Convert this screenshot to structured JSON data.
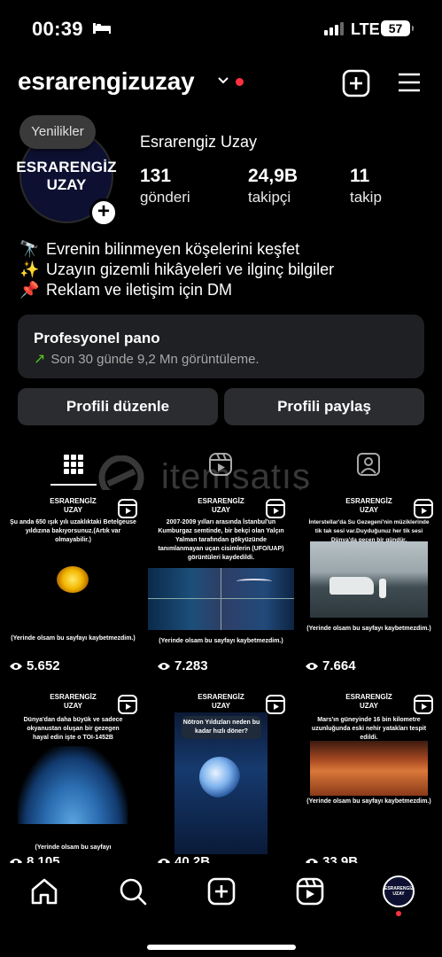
{
  "status_bar": {
    "time": "00:39",
    "network": "LTE",
    "battery": "57"
  },
  "header": {
    "username": "esrarengizuzay"
  },
  "profile": {
    "news_badge": "Yenilikler",
    "avatar_line1": "ESRARENGİZ",
    "avatar_line2": "UZAY",
    "display_name": "Esrarengiz Uzay",
    "stats": [
      {
        "value": "131",
        "label": "gönderi"
      },
      {
        "value": "24,9B",
        "label": "takipçi"
      },
      {
        "value": "11",
        "label": "takip"
      }
    ],
    "bio": [
      {
        "emoji": "🔭",
        "text": "Evrenin bilinmeyen köşelerini keşfet"
      },
      {
        "emoji": "✨",
        "text": "Uzayın gizemli hikâyeleri ve ilginç bilgiler"
      },
      {
        "emoji": "📌",
        "text": "Reklam ve iletişim için DM"
      }
    ]
  },
  "pro_dashboard": {
    "title": "Profesyonel pano",
    "subtitle": "Son 30 günde 9,2 Mn görüntüleme."
  },
  "buttons": {
    "edit": "Profili düzenle",
    "share": "Profili paylaş"
  },
  "watermark": "itemsatış",
  "posts": [
    {
      "brand": "ESRARENGİZ UZAY",
      "caption": "Şu anda 650 ışık yılı uzaklıktaki Betelgeuse yıldızına bakıyorsunuz.(Artık var olmayabilir.)",
      "footer": "(Yerinde olsam bu sayfayı kaybetmezdim.)",
      "views": "5.652"
    },
    {
      "brand": "ESRARENGİZ UZAY",
      "caption": "2007-2009 yılları arasında İstanbul'un Kumburgaz semtinde, bir bekçi olan Yalçın Yalman tarafından gökyüzünde tanımlanmayan uçan cisimlerin (UFO/UAP) görüntüleri kaydedildi.",
      "footer": "(Yerinde olsam bu sayfayı kaybetmezdim.)",
      "views": "7.283"
    },
    {
      "brand": "ESRARENGİZ UZAY",
      "caption": "İnterstellar'da Su Gezegeni'nin müziklerinde tik tak sesi var.Duyduğunuz her tik sesi Dünya'da geçen bir gündür.",
      "footer": "(Yerinde olsam bu sayfayı kaybetmezdim.)",
      "views": "7.664"
    },
    {
      "brand": "ESRARENGİZ UZAY",
      "caption": "Dünya'dan daha büyük ve sadece okyanustan oluşan bir gezegen hayal edin işte o TOI-1452B",
      "footer": "(Yerinde olsam bu sayfayı",
      "views": "8.105"
    },
    {
      "brand": "ESRARENGİZ UZAY",
      "caption": "Nötron Yıldızları neden bu kadar hızlı döner?",
      "footer": "",
      "views": "40,2B"
    },
    {
      "brand": "ESRARENGİZ UZAY",
      "caption": "Mars'ın güneyinde 16 bin kilometre uzunluğunda eski nehir yatakları tespit edildi.",
      "footer": "(Yerinde olsam bu sayfayı kaybetmezdim.)",
      "views": "33,9B"
    }
  ],
  "icons": {
    "header": [
      "chevron-down-icon",
      "create-post-icon",
      "hamburger-menu-icon"
    ],
    "tabs": [
      "grid-icon",
      "reels-icon",
      "tagged-icon"
    ],
    "nav": [
      "home-icon",
      "search-icon",
      "create-icon",
      "reels-icon",
      "profile-avatar"
    ]
  },
  "colors": {
    "notification": "#ff3040",
    "growth_arrow": "#58c322",
    "card_bg": "#1f2023",
    "button_bg": "#2b2c30"
  }
}
